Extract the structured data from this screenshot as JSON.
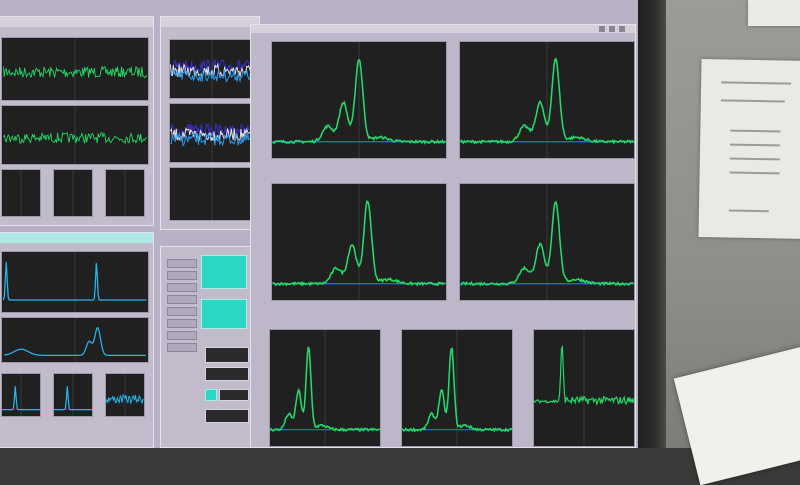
{
  "scene": {
    "description_colors": {
      "screen_bg": "#b9b2c6",
      "plot_bg": "#202020",
      "trace_green": "#25d968",
      "trace_cyan": "#27b6f0",
      "baseline_blue": "#2a6cf0"
    }
  },
  "windows": {
    "left_top_title": "",
    "middle_title": "",
    "main_title": "",
    "main_subtitle": ""
  },
  "icons": [
    "close-icon",
    "maximize-icon",
    "minimize-icon"
  ]
}
